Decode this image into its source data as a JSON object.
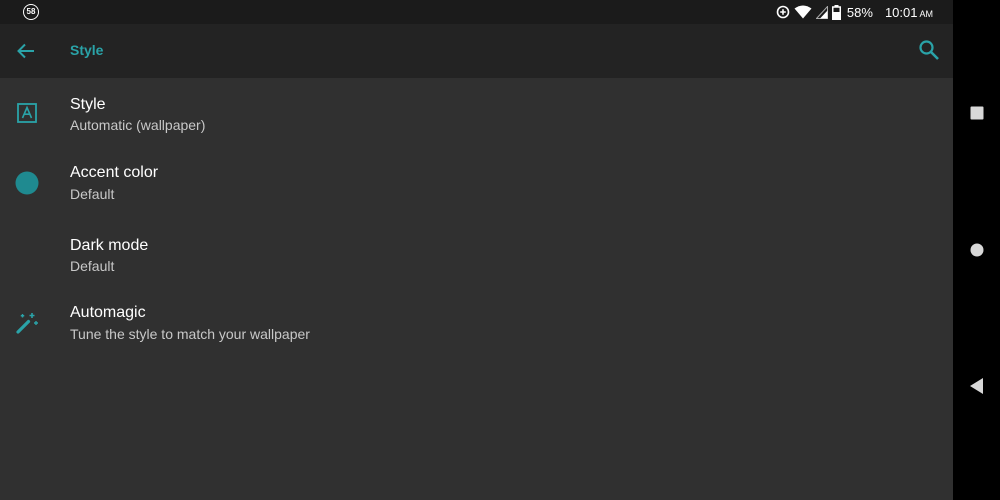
{
  "status_bar": {
    "notification_badge": "58",
    "battery_percent": "58%",
    "time": "10:01",
    "time_suffix": "AM",
    "icons": [
      "data-saver-icon",
      "wifi-icon",
      "cell-signal-icon",
      "battery-icon"
    ]
  },
  "toolbar": {
    "title": "Style",
    "back_icon": "arrow-back-icon",
    "search_icon": "search-icon"
  },
  "settings": [
    {
      "title": "Style",
      "summary": "Automatic (wallpaper)",
      "icon": "style-icon"
    },
    {
      "title": "Accent color",
      "summary": "Default",
      "icon": "accent-color-icon"
    },
    {
      "title": "Dark mode",
      "summary": "Default",
      "icon": ""
    },
    {
      "title": "Automagic",
      "summary": "Tune the style to match your wallpaper",
      "icon": "magic-wand-icon"
    }
  ],
  "nav_bar": {
    "icons": [
      "recents-icon",
      "home-icon",
      "back-icon"
    ]
  },
  "colors": {
    "accent": "#2aa3a8",
    "background": "#303030",
    "toolbar": "#232323",
    "status_bar": "#1b1b1b"
  }
}
